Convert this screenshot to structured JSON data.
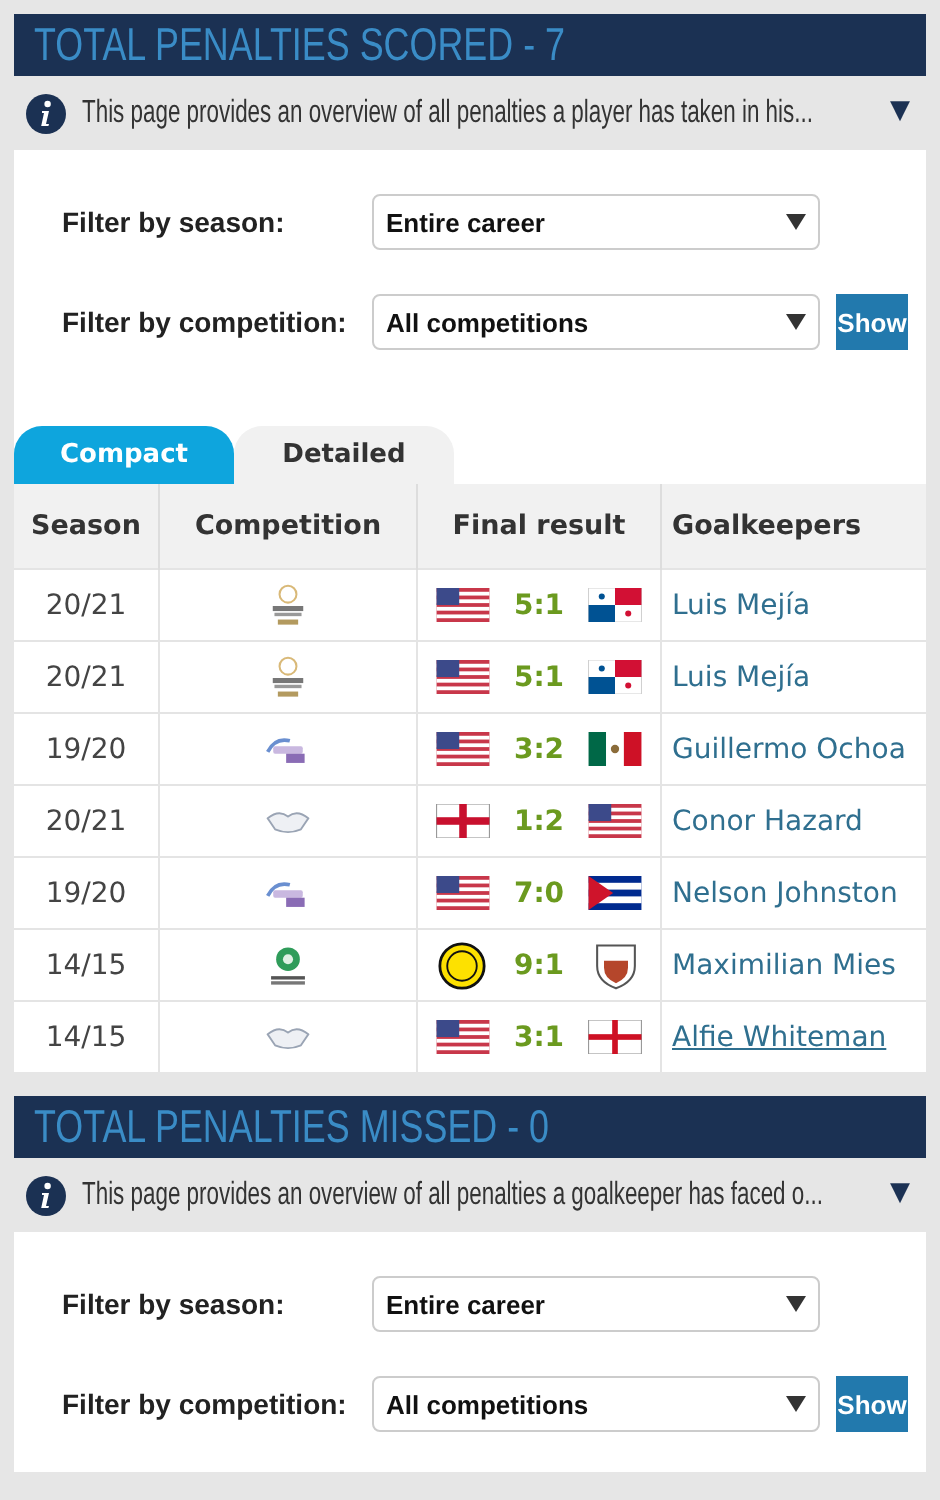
{
  "sections": [
    {
      "title": "TOTAL PENALTIES SCORED - 7",
      "info": "This page provides an overview of all penalties a player has taken in his...",
      "info_toggle": "▼",
      "filters": [
        {
          "label": "Filter by season:",
          "value": "Entire career"
        },
        {
          "label": "Filter by competition:",
          "value": "All competitions"
        }
      ],
      "show_button": "Show",
      "tabs": [
        {
          "label": "Compact",
          "selected": true
        },
        {
          "label": "Detailed",
          "selected": false
        }
      ],
      "table": {
        "columns": [
          "Season",
          "Competition",
          "Final result",
          "Goalkeepers"
        ],
        "rows": [
          {
            "season": "20/21",
            "competition": {
              "kind": "qualifiers"
            },
            "home": {
              "kind": "us"
            },
            "result": "5:1",
            "away": {
              "kind": "pa"
            },
            "goalkeeper": "Luis Mejía",
            "hovered": false
          },
          {
            "season": "20/21",
            "competition": {
              "kind": "qualifiers"
            },
            "home": {
              "kind": "us"
            },
            "result": "5:1",
            "away": {
              "kind": "pa"
            },
            "goalkeeper": "Luis Mejía",
            "hovered": false
          },
          {
            "season": "19/20",
            "competition": {
              "kind": "league"
            },
            "home": {
              "kind": "us"
            },
            "result": "3:2",
            "away": {
              "kind": "mx"
            },
            "goalkeeper": "Guillermo Ochoa",
            "hovered": false
          },
          {
            "season": "20/21",
            "competition": {
              "kind": "friendly"
            },
            "home": {
              "kind": "nir"
            },
            "result": "1:2",
            "away": {
              "kind": "us"
            },
            "goalkeeper": "Conor Hazard",
            "hovered": false
          },
          {
            "season": "19/20",
            "competition": {
              "kind": "league"
            },
            "home": {
              "kind": "us"
            },
            "result": "7:0",
            "away": {
              "kind": "cu"
            },
            "goalkeeper": "Nelson Johnston",
            "hovered": false
          },
          {
            "season": "14/15",
            "competition": {
              "kind": "youth"
            },
            "home": {
              "kind": "club-round"
            },
            "result": "9:1",
            "away": {
              "kind": "club-shield"
            },
            "goalkeeper": "Maximilian Mies",
            "hovered": false
          },
          {
            "season": "14/15",
            "competition": {
              "kind": "friendly"
            },
            "home": {
              "kind": "us"
            },
            "result": "3:1",
            "away": {
              "kind": "en"
            },
            "goalkeeper": "Alfie Whiteman",
            "hovered": true
          }
        ]
      }
    },
    {
      "title": "TOTAL PENALTIES MISSED - 0",
      "info": "This page provides an overview of all penalties a goalkeeper has faced o...",
      "info_toggle": "▼",
      "filters": [
        {
          "label": "Filter by season:",
          "value": "Entire career"
        },
        {
          "label": "Filter by competition:",
          "value": "All competitions"
        }
      ],
      "show_button": "Show"
    }
  ]
}
